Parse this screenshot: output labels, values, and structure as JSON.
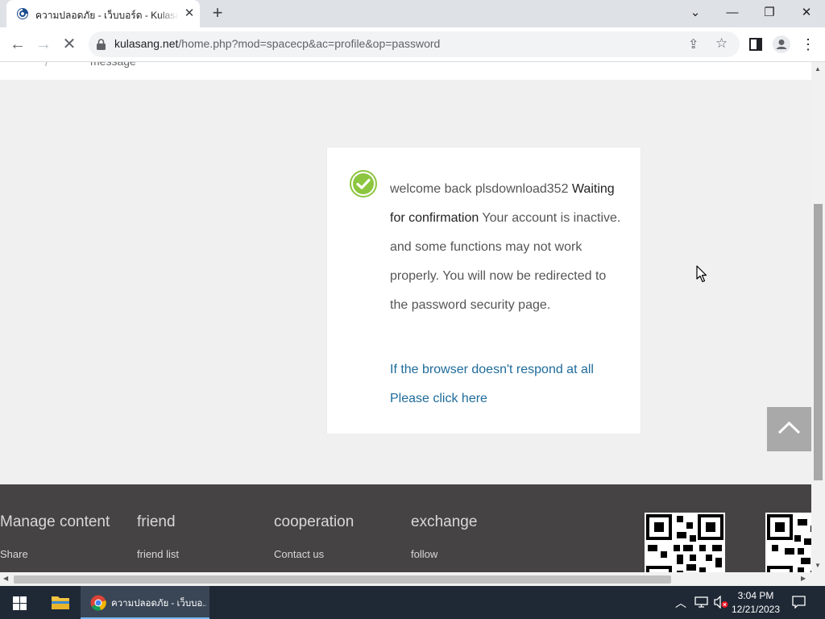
{
  "browser": {
    "tab_title": "ความปลอดภัย - เว็บบอร์ด - Kulasang",
    "url_host": "kulasang.net",
    "url_path": "/home.php?mod=spacecp&ac=profile&op=password",
    "close_icon": "✕",
    "new_tab_icon": "+"
  },
  "page": {
    "header_text": "message",
    "message": {
      "part1": "welcome back plsdownload352 ",
      "part2": "Waiting for confirmation",
      "part3": " Your account is inactive. and some functions may not work properly. You will now be redirected to the password security page."
    },
    "redirect_line1": "If the browser doesn't respond at all",
    "redirect_line2": "Please click here"
  },
  "footer": {
    "columns": [
      {
        "heading": "Manage content",
        "link": "Share"
      },
      {
        "heading": "friend",
        "link": "friend list"
      },
      {
        "heading": "cooperation",
        "link": "Contact us"
      },
      {
        "heading": "exchange",
        "link": "follow"
      }
    ]
  },
  "taskbar": {
    "chrome_label": "ความปลอดภัย - เว็บบอ...",
    "time": "3:04 PM",
    "date": "12/21/2023"
  },
  "colors": {
    "accent_green": "#8cc63f",
    "link_blue": "#1e6b9a",
    "footer_bg": "#464344"
  }
}
